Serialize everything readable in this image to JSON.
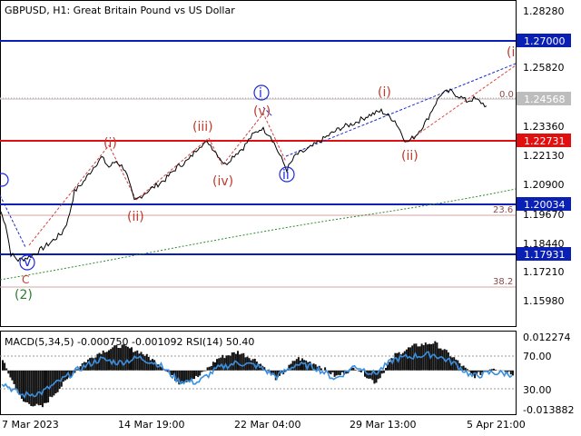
{
  "title": "GBPUSD, H1:  Great Britain Pound vs US Dollar",
  "price_ticks": [
    "1.28280",
    "1.25820",
    "1.23360",
    "1.22130",
    "1.20900",
    "1.19670",
    "1.18440",
    "1.17210",
    "1.15980"
  ],
  "level_labels": [
    {
      "text": "1.27000",
      "color": "#0a1fb4"
    },
    {
      "text": "1.24568",
      "color": "#bdbdbd"
    },
    {
      "text": "1.22731",
      "color": "#e01010"
    },
    {
      "text": "1.20034",
      "color": "#0a1fb4"
    },
    {
      "text": "1.17931",
      "color": "#0a1fb4"
    }
  ],
  "fib_labels": [
    "0.0",
    "23.6",
    "38.2"
  ],
  "wave_labels": [
    {
      "text": "(i)",
      "color": "red"
    },
    {
      "text": "(ii)",
      "color": "red"
    },
    {
      "text": "(iii)",
      "color": "red"
    },
    {
      "text": "(iv)",
      "color": "red"
    },
    {
      "text": "(v)",
      "color": "red"
    },
    {
      "text": "(i)",
      "color": "red"
    },
    {
      "text": "(ii)",
      "color": "red"
    },
    {
      "text": "(i",
      "color": "red"
    },
    {
      "text": "C",
      "color": "red"
    },
    {
      "text": "i",
      "color": "blue"
    },
    {
      "text": "ii",
      "color": "blue"
    },
    {
      "text": "v",
      "color": "blue"
    },
    {
      "text": "(2)",
      "color": "green"
    }
  ],
  "indicator": {
    "label": "MACD(5,34,5) -0.000750 -0.001092 RSI(14) 50.40",
    "ticks": [
      "0.012274",
      "70.00",
      "30.00",
      "-0.013882"
    ]
  },
  "time_ticks": [
    "7 Mar 2023",
    "14 Mar 19:00",
    "22 Mar 04:00",
    "29 Mar 13:00",
    "5 Apr 21:00"
  ],
  "chart_data": {
    "type": "line",
    "symbol": "GBPUSD",
    "timeframe": "H1",
    "ylim": [
      1.154,
      1.287
    ],
    "price_path": [
      [
        0,
        1.2015
      ],
      [
        6,
        1.196
      ],
      [
        12,
        1.1835
      ],
      [
        20,
        1.181
      ],
      [
        30,
        1.182
      ],
      [
        40,
        1.184
      ],
      [
        55,
        1.188
      ],
      [
        68,
        1.192
      ],
      [
        75,
        1.1975
      ],
      [
        82,
        1.209
      ],
      [
        92,
        1.213
      ],
      [
        105,
        1.22
      ],
      [
        112,
        1.223
      ],
      [
        120,
        1.219
      ],
      [
        128,
        1.2215
      ],
      [
        138,
        1.218
      ],
      [
        148,
        1.205
      ],
      [
        158,
        1.208
      ],
      [
        170,
        1.211
      ],
      [
        182,
        1.214
      ],
      [
        195,
        1.219
      ],
      [
        208,
        1.222
      ],
      [
        220,
        1.228
      ],
      [
        230,
        1.229
      ],
      [
        238,
        1.225
      ],
      [
        248,
        1.22
      ],
      [
        258,
        1.224
      ],
      [
        268,
        1.227
      ],
      [
        278,
        1.232
      ],
      [
        288,
        1.235
      ],
      [
        298,
        1.232
      ],
      [
        308,
        1.224
      ],
      [
        316,
        1.218
      ],
      [
        326,
        1.224
      ],
      [
        338,
        1.226
      ],
      [
        350,
        1.229
      ],
      [
        362,
        1.232
      ],
      [
        375,
        1.235
      ],
      [
        390,
        1.237
      ],
      [
        405,
        1.24
      ],
      [
        420,
        1.242
      ],
      [
        435,
        1.238
      ],
      [
        448,
        1.229
      ],
      [
        458,
        1.232
      ],
      [
        470,
        1.238
      ],
      [
        478,
        1.244
      ],
      [
        486,
        1.249
      ],
      [
        496,
        1.25
      ],
      [
        506,
        1.248
      ],
      [
        514,
        1.246
      ],
      [
        522,
        1.247
      ],
      [
        530,
        1.2455
      ],
      [
        536,
        1.244
      ]
    ],
    "horizontal_levels": [
      1.27,
      1.24568,
      1.22731,
      1.20034,
      1.17931,
      1.1975,
      1.167
    ],
    "macd_path": [
      0.003,
      -0.01,
      -0.012,
      -0.005,
      0.002,
      0.006,
      0.008,
      0.006,
      0.002,
      -0.004,
      -0.002,
      0.004,
      0.006,
      0.003,
      -0.003,
      0.004,
      0.002,
      -0.002,
      0.001,
      -0.004,
      0.005,
      0.008,
      0.009,
      0.004,
      -0.002,
      0.001,
      -0.001
    ],
    "rsi_path": [
      38,
      22,
      25,
      40,
      55,
      66,
      62,
      68,
      60,
      40,
      38,
      55,
      62,
      58,
      45,
      60,
      56,
      42,
      58,
      48,
      66,
      70,
      72,
      62,
      45,
      50,
      48
    ]
  }
}
